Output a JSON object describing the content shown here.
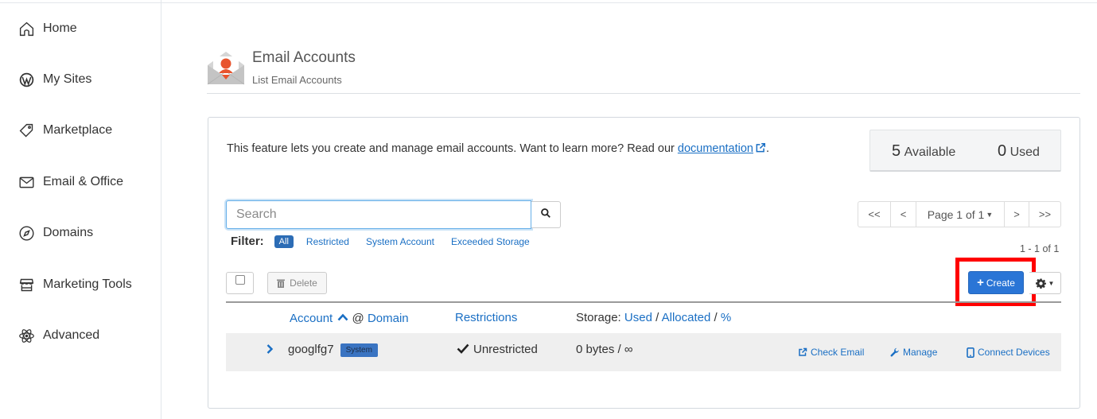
{
  "sidebar": {
    "items": [
      {
        "label": "Home",
        "icon": "home-icon"
      },
      {
        "label": "My Sites",
        "icon": "wordpress-icon"
      },
      {
        "label": "Marketplace",
        "icon": "tag-icon"
      },
      {
        "label": "Email & Office",
        "icon": "envelope-icon"
      },
      {
        "label": "Domains",
        "icon": "compass-icon"
      },
      {
        "label": "Marketing Tools",
        "icon": "storefront-icon"
      },
      {
        "label": "Advanced",
        "icon": "atom-icon"
      }
    ]
  },
  "header": {
    "title": "Email Accounts",
    "subtitle": "List Email Accounts"
  },
  "intro": {
    "text": "This feature lets you create and manage email accounts. Want to learn more? Read our ",
    "link_text": "documentation",
    "suffix": "."
  },
  "stats": {
    "available_count": "5",
    "available_label": "Available",
    "used_count": "0",
    "used_label": "Used"
  },
  "search": {
    "placeholder": "Search",
    "value": ""
  },
  "filter": {
    "label": "Filter:",
    "options": [
      "All",
      "Restricted",
      "System Account",
      "Exceeded Storage"
    ],
    "selected": "All"
  },
  "pagination": {
    "first": "<<",
    "prev": "<",
    "page_label": "Page 1 of 1",
    "next": ">",
    "last": ">>",
    "results": "1 - 1 of 1"
  },
  "toolbar": {
    "delete_label": "Delete",
    "create_label": "Create"
  },
  "table": {
    "headers": {
      "account": "Account",
      "at": "@",
      "domain": "Domain",
      "restrictions": "Restrictions",
      "storage_prefix": "Storage:",
      "used": "Used",
      "sep1": "/",
      "allocated": "Allocated",
      "sep2": "/",
      "percent": "%"
    },
    "rows": [
      {
        "account": "googlfg7",
        "badge": "System",
        "restriction": "Unrestricted",
        "storage": "0 bytes / ∞",
        "actions": [
          "Check Email",
          "Manage",
          "Connect Devices"
        ]
      }
    ]
  },
  "colors": {
    "accent": "#2a75d6",
    "link": "#1a6fc4",
    "highlight": "#ff0000"
  }
}
